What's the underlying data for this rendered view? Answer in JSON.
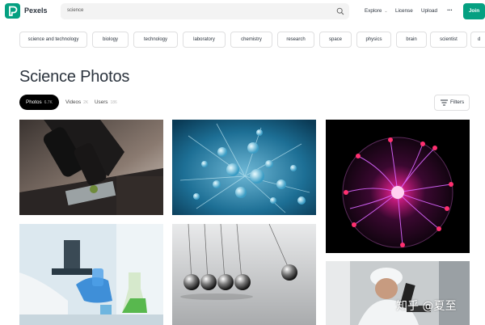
{
  "header": {
    "brand": "Pexels",
    "search": {
      "value": "science"
    },
    "nav": {
      "explore": "Explore",
      "license": "License",
      "upload": "Upload",
      "more": "···"
    },
    "join": "Join"
  },
  "chips": [
    "science and technology",
    "biology",
    "technology",
    "laboratory",
    "chemistry",
    "research",
    "space",
    "physics",
    "brain",
    "scientist",
    "d"
  ],
  "page_title": "Science Photos",
  "tabs": {
    "photos": {
      "label": "Photos",
      "count": "6.7K"
    },
    "videos": {
      "label": "Videos",
      "count": "2K"
    },
    "users": {
      "label": "Users",
      "count": "186"
    }
  },
  "filters": "Filters",
  "watermark": "知乎 @夏至",
  "colors": {
    "brand": "#05a081",
    "text": "#2c343e",
    "border": "#dfdfe0"
  }
}
